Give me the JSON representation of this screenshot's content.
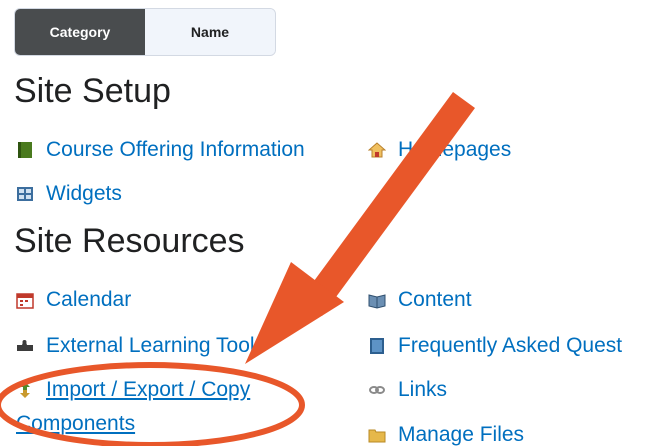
{
  "toggle": {
    "category_label": "Category",
    "name_label": "Name",
    "active": "Category"
  },
  "sections": [
    {
      "heading": "Site Setup",
      "items": [
        {
          "label": "Course Offering Information",
          "icon": "book-icon"
        },
        {
          "label": "Homepages",
          "icon": "home-icon"
        },
        {
          "label": "Widgets",
          "icon": "widgets-icon"
        }
      ]
    },
    {
      "heading": "Site Resources",
      "items": [
        {
          "label": "Calendar",
          "icon": "calendar-icon"
        },
        {
          "label": "Content",
          "icon": "content-icon"
        },
        {
          "label": "External Learning Tools",
          "icon": "puzzle-icon"
        },
        {
          "label": "Frequently Asked Quest",
          "icon": "faq-icon"
        },
        {
          "label_line1": "Import / Export / Copy",
          "label_line2": "Components",
          "icon": "import-export-icon"
        },
        {
          "label": "Links",
          "icon": "links-icon"
        },
        {
          "label": "Manage Files",
          "icon": "folder-icon"
        }
      ]
    }
  ],
  "annotation": {
    "arrow_color": "#e8572a",
    "circle_color": "#e8572a"
  }
}
